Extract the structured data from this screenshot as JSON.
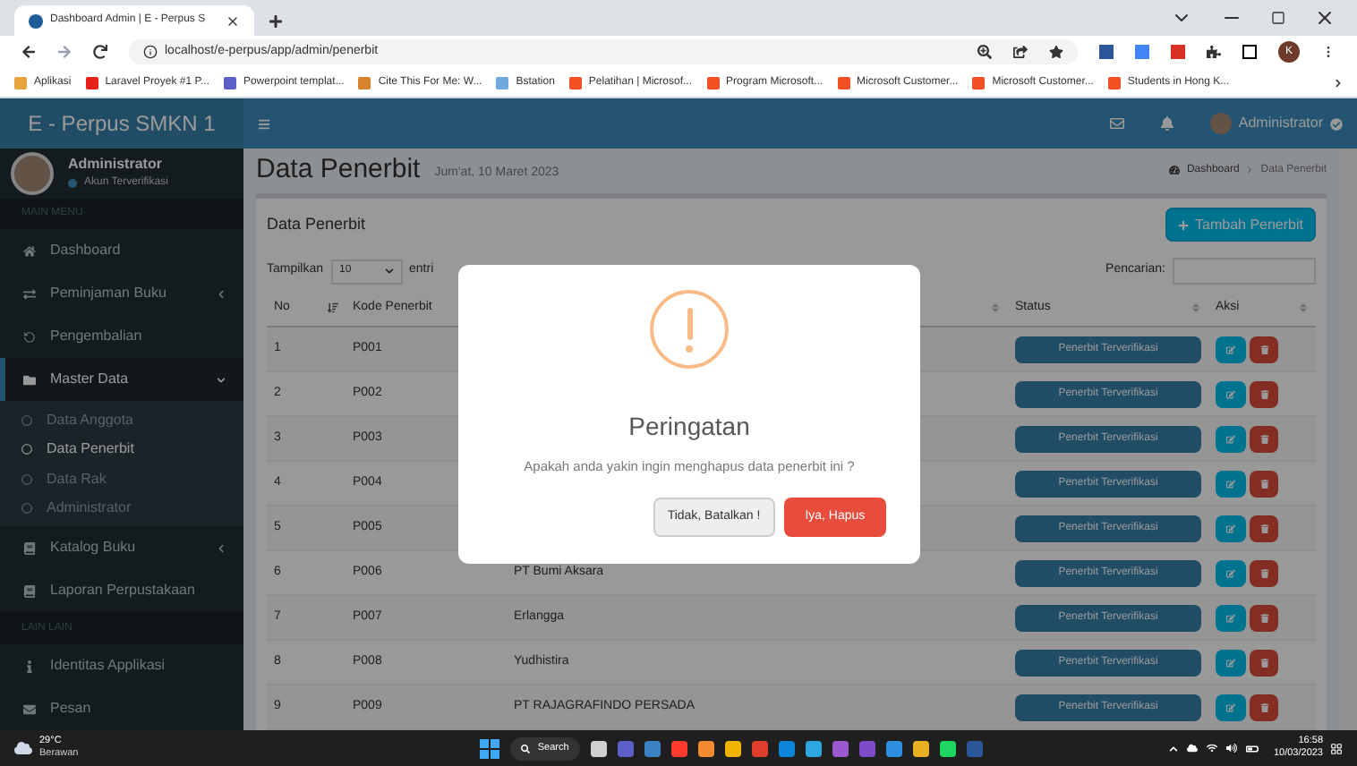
{
  "browser": {
    "tab": {
      "title": "Dashboard Admin | E - Perpus S"
    },
    "address": {
      "url": "localhost/e-perpus/app/admin/penerbit"
    },
    "profile_initial": "K",
    "bookmarks": [
      {
        "label": "Aplikasi",
        "color": "#e8a33d"
      },
      {
        "label": "Laravel Proyek #1 P...",
        "color": "#e62117"
      },
      {
        "label": "Powerpoint templat...",
        "color": "#5b5fc7"
      },
      {
        "label": "Cite This For Me: W...",
        "color": "#d9822b"
      },
      {
        "label": "Bstation",
        "color": "#6fa8dc"
      },
      {
        "label": "Pelatihan | Microsof...",
        "color": "#f25022"
      },
      {
        "label": "Program Microsoft...",
        "color": "#f25022"
      },
      {
        "label": "Microsoft Customer...",
        "color": "#f25022"
      },
      {
        "label": "Microsoft Customer...",
        "color": "#f25022"
      },
      {
        "label": "Students in Hong K...",
        "color": "#f25022"
      }
    ]
  },
  "app": {
    "brand": "E - Perpus SMKN 1",
    "header": {
      "user_name": "Administrator"
    },
    "sidebar": {
      "user": {
        "name": "Administrator",
        "status": "Akun Terverifikasi"
      },
      "entries": [
        {
          "kind": "header",
          "label": "MAIN MENU"
        },
        {
          "kind": "item",
          "label": "Dashboard",
          "selected": false
        },
        {
          "kind": "item",
          "label": "Peminjaman Buku",
          "selected": false,
          "expanded": false
        },
        {
          "kind": "item",
          "label": "Pengembalian",
          "selected": false
        },
        {
          "kind": "item",
          "label": "Master Data",
          "selected": true,
          "expanded": true,
          "children": [
            {
              "label": "Data Anggota",
              "selected": false
            },
            {
              "label": "Data Penerbit",
              "selected": true
            },
            {
              "label": "Data Rak",
              "selected": false
            },
            {
              "label": "Administrator",
              "selected": false
            }
          ]
        },
        {
          "kind": "item",
          "label": "Katalog Buku",
          "selected": false,
          "expanded": false
        },
        {
          "kind": "item",
          "label": "Laporan Perpustakaan",
          "selected": false
        },
        {
          "kind": "header",
          "label": "LAIN LAIN"
        },
        {
          "kind": "item",
          "label": "Identitas Applikasi",
          "selected": false
        },
        {
          "kind": "item",
          "label": "Pesan",
          "selected": false
        }
      ]
    },
    "page": {
      "title": "Data Penerbit",
      "date": "Jum'at, 10 Maret 2023",
      "breadcrumb": [
        "Dashboard",
        "Data Penerbit"
      ]
    },
    "box": {
      "title": "Data Penerbit",
      "add_button": "Tambah Penerbit",
      "length_before": "Tampilkan",
      "length_value": "10",
      "length_after": "entri",
      "search_label": "Pencarian:",
      "columns": [
        {
          "label": "No",
          "sorted": true
        },
        {
          "label": "Kode Penerbit"
        },
        {
          "sorted": false
        },
        {
          "label": "Status",
          "sorted": false
        },
        {
          "label": "Aksi",
          "sorted": false
        }
      ],
      "rows": [
        {
          "no": "1",
          "code": "P001",
          "status": "Penerbit Terverifikasi"
        },
        {
          "no": "2",
          "code": "P002",
          "status": "Penerbit Terverifikasi"
        },
        {
          "no": "3",
          "code": "P003",
          "status": "Penerbit Terverifikasi"
        },
        {
          "no": "4",
          "code": "P004",
          "status": "Penerbit Terverifikasi"
        },
        {
          "no": "5",
          "code": "P005",
          "status": "Penerbit Terverifikasi"
        },
        {
          "no": "6",
          "code": "P006",
          "name": "PT Bumi Aksara",
          "status": "Penerbit Terverifikasi"
        },
        {
          "no": "7",
          "code": "P007",
          "name": "Erlangga",
          "status": "Penerbit Terverifikasi"
        },
        {
          "no": "8",
          "code": "P008",
          "name": "Yudhistira",
          "status": "Penerbit Terverifikasi"
        },
        {
          "no": "9",
          "code": "P009",
          "name": "PT RAJAGRAFINDO PERSADA",
          "status": "Penerbit Terverifikasi"
        }
      ]
    },
    "modal": {
      "title": "Peringatan",
      "message": "Apakah anda yakin ingin menghapus data penerbit ini ?",
      "cancel": "Tidak, Batalkan !",
      "confirm": "Iya, Hapus"
    }
  },
  "taskbar": {
    "weather": {
      "temperature": "29°C",
      "condition": "Berawan"
    },
    "search": "Search",
    "time": "16:58",
    "date": "10/03/2023"
  }
}
